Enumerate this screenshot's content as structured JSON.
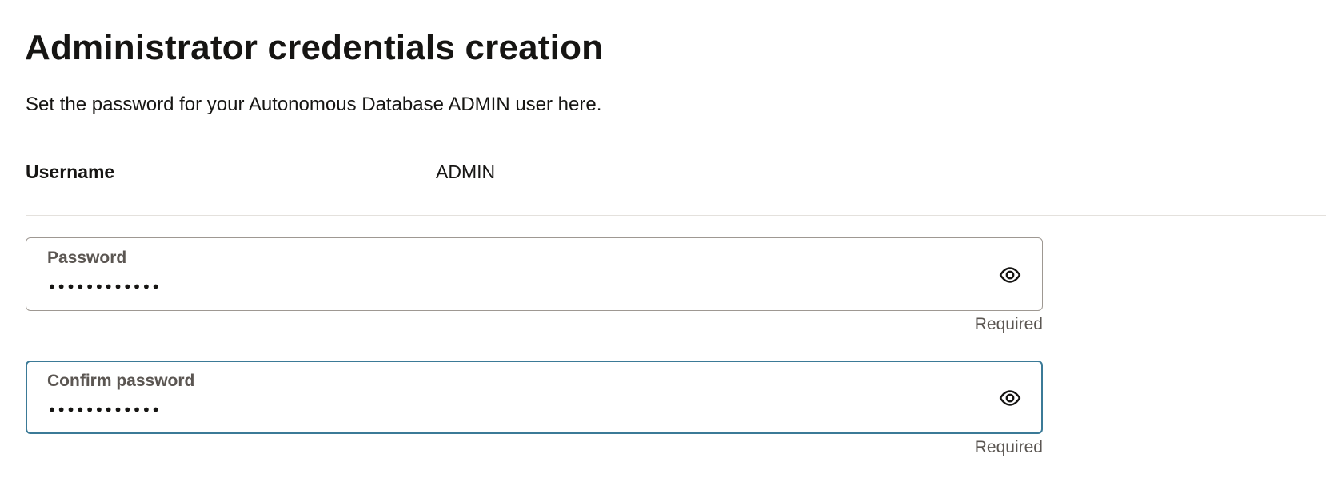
{
  "header": {
    "title": "Administrator credentials creation",
    "description": "Set the password for your Autonomous Database ADMIN user here."
  },
  "username": {
    "label": "Username",
    "value": "ADMIN"
  },
  "password_field": {
    "label": "Password",
    "value": "••••••••••••",
    "helper": "Required",
    "icon": "eye-icon"
  },
  "confirm_field": {
    "label": "Confirm password",
    "value": "••••••••••••",
    "helper": "Required",
    "icon": "eye-icon",
    "focused": true
  },
  "colors": {
    "text": "#161513",
    "muted": "#5b5652",
    "border": "#9e9892",
    "focus_border": "#3b7a97",
    "divider": "#e4e1dd"
  }
}
